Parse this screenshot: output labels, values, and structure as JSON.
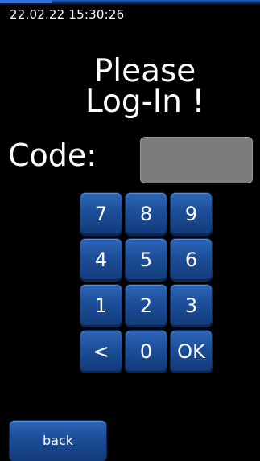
{
  "status_bar": {
    "datetime": "22.02.22  15:30:26"
  },
  "login": {
    "title_line1": "Please",
    "title_line2": "Log-In !",
    "code_label": "Code:",
    "code_value": ""
  },
  "keypad": {
    "keys": {
      "k7": "7",
      "k8": "8",
      "k9": "9",
      "k4": "4",
      "k5": "5",
      "k6": "6",
      "k1": "1",
      "k2": "2",
      "k3": "3",
      "backspace": "<",
      "k0": "0",
      "ok": "OK"
    }
  },
  "footer": {
    "back_label": "back"
  },
  "colors": {
    "background": "#000000",
    "key_blue": "#1d4f9a",
    "field_gray": "#7b7b7b",
    "top_accent": "#2a6fe0"
  }
}
